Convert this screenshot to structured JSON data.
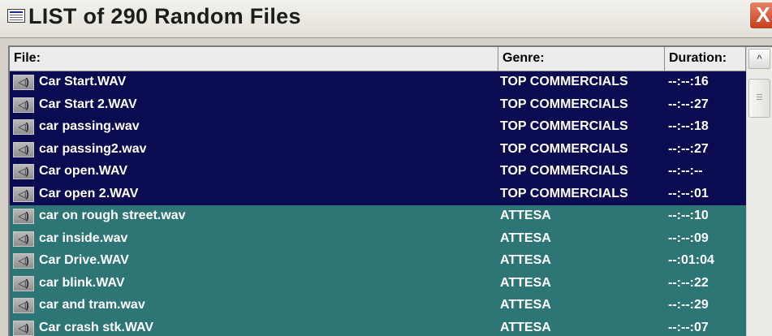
{
  "window": {
    "title": "LIST of 290 Random Files",
    "close_glyph": "X",
    "app_icon": "list-window-icon"
  },
  "list": {
    "columns": {
      "file": "File:",
      "genre": "Genre:",
      "duration": "Duration:"
    },
    "row_icon": "speaker-icon",
    "row_icon_glyph": "◁)",
    "rows": [
      {
        "file": "Car Start.WAV",
        "genre": "TOP COMMERCIALS",
        "duration": "--:--:16",
        "style": "sel"
      },
      {
        "file": "Car Start 2.WAV",
        "genre": "TOP COMMERCIALS",
        "duration": "--:--:27",
        "style": "sel"
      },
      {
        "file": "car passing.wav",
        "genre": "TOP COMMERCIALS",
        "duration": "--:--:18",
        "style": "sel"
      },
      {
        "file": "car passing2.wav",
        "genre": "TOP COMMERCIALS",
        "duration": "--:--:27",
        "style": "sel"
      },
      {
        "file": "Car open.WAV",
        "genre": "TOP COMMERCIALS",
        "duration": "--:--:--",
        "style": "sel"
      },
      {
        "file": "Car open 2.WAV",
        "genre": "TOP COMMERCIALS",
        "duration": "--:--:01",
        "style": "sel"
      },
      {
        "file": "car on rough street.wav",
        "genre": "ATTESA",
        "duration": "--:--:10",
        "style": "alt"
      },
      {
        "file": "car inside.wav",
        "genre": "ATTESA",
        "duration": "--:--:09",
        "style": "alt"
      },
      {
        "file": "Car Drive.WAV",
        "genre": "ATTESA",
        "duration": "--:01:04",
        "style": "alt"
      },
      {
        "file": "car blink.WAV",
        "genre": "ATTESA",
        "duration": "--:--:22",
        "style": "alt"
      },
      {
        "file": "car and tram.wav",
        "genre": "ATTESA",
        "duration": "--:--:29",
        "style": "alt"
      },
      {
        "file": "Car crash stk.WAV",
        "genre": "ATTESA",
        "duration": "--:--:07",
        "style": "alt"
      }
    ]
  },
  "scrollbar": {
    "up_glyph": "^"
  },
  "colors": {
    "selected_row_bg": "#0b0b52",
    "alt_row_bg": "#2e7676",
    "row_text": "#ffffff",
    "close_button": "#c93d1d"
  }
}
